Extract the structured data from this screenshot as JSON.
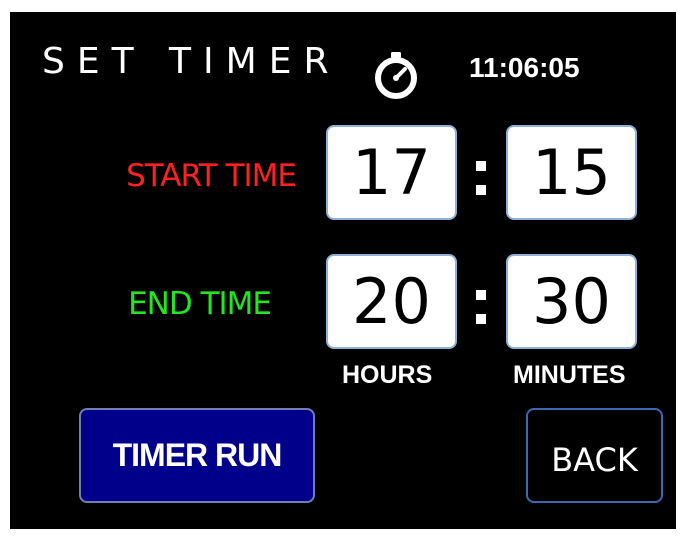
{
  "header": {
    "title": "SET TIMER",
    "icon": "stopwatch-icon",
    "clock": "11:06:05"
  },
  "start_time": {
    "label": "START TIME",
    "hours": "17",
    "minutes": "15",
    "color": "#ff2020"
  },
  "end_time": {
    "label": "END TIME",
    "hours": "20",
    "minutes": "30",
    "color": "#22e61f"
  },
  "units": {
    "hours": "HOURS",
    "minutes": "MINUTES"
  },
  "buttons": {
    "timer_run": "TIMER RUN",
    "back": "BACK"
  },
  "colors": {
    "screen": "#000000",
    "timer_run_button": "#00008b",
    "box_border": "#8fb1d9",
    "back_border": "#3b68b3"
  }
}
